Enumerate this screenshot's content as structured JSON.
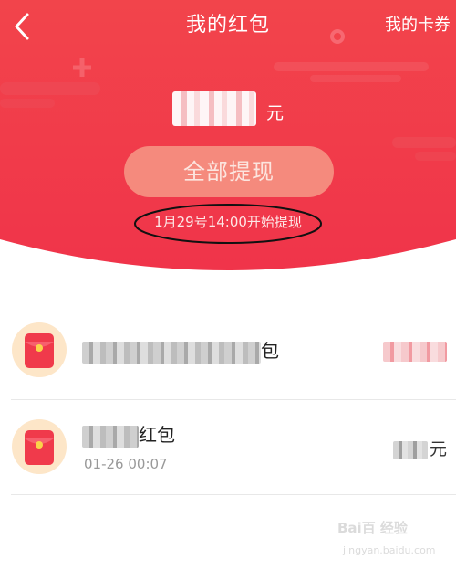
{
  "header": {
    "title": "我的红包",
    "right_link": "我的卡券",
    "back_icon": "chevron-left-icon",
    "background_color": "#f23d4a"
  },
  "balance": {
    "amount": "",
    "unit": "元"
  },
  "withdraw": {
    "button_label": "全部提现",
    "button_color": "#f58a7d",
    "notice": "1月29号14:00开始提现"
  },
  "list": {
    "items": [
      {
        "icon": "red-envelope-icon",
        "title_suffix": "包",
        "date": "",
        "amount": ""
      },
      {
        "icon": "red-envelope-icon",
        "title_suffix": "红包",
        "date": "01-26 00:07",
        "amount_unit": "元"
      }
    ]
  },
  "watermark": {
    "logo_text": "Bai百 经验",
    "site": "jingyan.baidu.com"
  }
}
